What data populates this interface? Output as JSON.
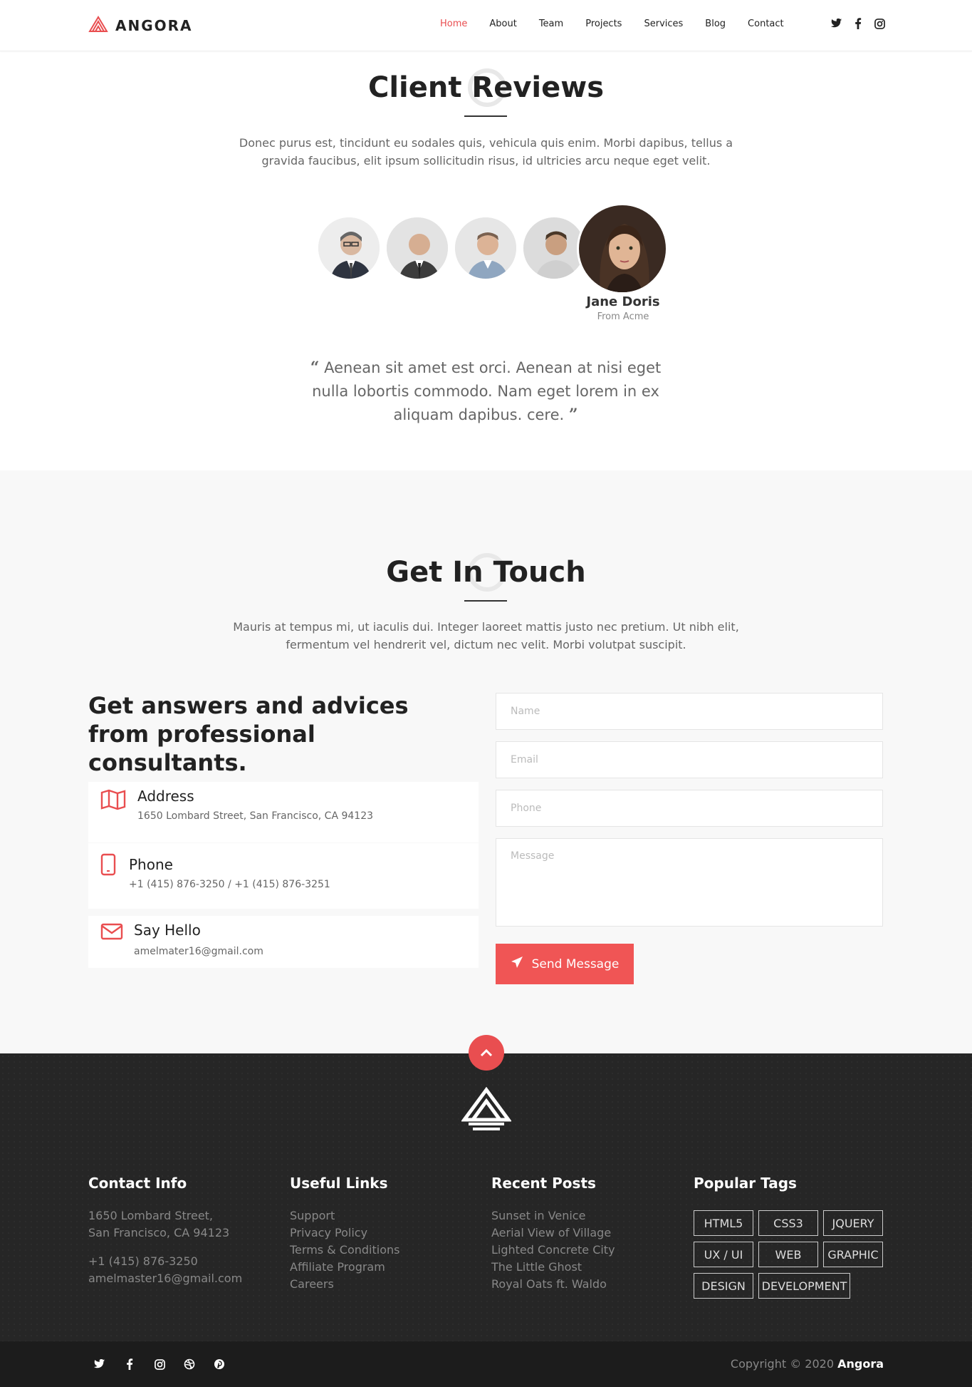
{
  "header": {
    "brand": "ANGORA",
    "nav": [
      "Home",
      "About",
      "Team",
      "Projects",
      "Services",
      "Blog",
      "Contact"
    ],
    "active": "Home",
    "social_icons": [
      "twitter-icon",
      "facebook-icon",
      "instagram-icon"
    ]
  },
  "reviews": {
    "title": "Client Reviews",
    "subtitle_line1": "Donec purus est, tincidunt eu sodales quis, vehicula quis enim. Morbi dapibus, tellus a",
    "subtitle_line2": "gravida faucibus, elit ipsum sollicitudin risus, id ultricies arcu neque eget velit.",
    "active_name": "Jane Doris",
    "active_company": "From Acme",
    "quote": "Aenean sit amet est orci. Aenean at nisi eget nulla lobortis commodo. Nam eget lorem in ex aliquam dapibus. cere."
  },
  "touch": {
    "title": "Get In Touch",
    "subtitle_line1": "Mauris at tempus mi, ut iaculis dui. Integer laoreet mattis justo nec pretium. Ut nibh elit,",
    "subtitle_line2": "fermentum vel hendrerit vel, dictum nec velit. Morbi volutpat suscipit.",
    "heading": "Get answers and advices from professional consultants.",
    "address_title": "Address",
    "address": "1650 Lombard Street, San Francisco, CA 94123",
    "phone_title": "Phone",
    "phone": "+1 (415) 876-3250 / +1 (415) 876-3251",
    "hello_title": "Say Hello",
    "email": "amelmater16@gmail.com",
    "placeholders": {
      "name": "Name",
      "email": "Email",
      "phone": "Phone",
      "message": "Message"
    },
    "send_label": "Send Message"
  },
  "footer": {
    "contact_title": "Contact Info",
    "contact_line1": "1650 Lombard Street,",
    "contact_line2": "San Francisco, CA 94123",
    "contact_phone": "+1 (415) 876-3250",
    "contact_email": "amelmaster16@gmail.com",
    "links_title": "Useful Links",
    "links": [
      "Support",
      "Privacy Policy",
      "Terms & Conditions",
      "Affiliate Program",
      "Careers"
    ],
    "posts_title": "Recent Posts",
    "posts": [
      "Sunset in Venice",
      "Aerial View of Village",
      "Lighted Concrete City",
      "The Little Ghost",
      "Royal Oats ft. Waldo"
    ],
    "tags_title": "Popular Tags",
    "tags": [
      "HTML5",
      "CSS3",
      "JQUERY",
      "UX / UI",
      "WEB",
      "GRAPHIC",
      "DESIGN",
      "DEVELOPMENT"
    ],
    "copyright_prefix": "Copyright © 2020",
    "copyright_brand": "Angora",
    "bottom_social": [
      "twitter-icon",
      "facebook-icon",
      "instagram-icon",
      "dribbble-icon",
      "pinterest-icon"
    ]
  },
  "colors": {
    "accent": "#e94e50",
    "footer": "#262626",
    "bottom_bar": "#1c1c1c",
    "section_bg": "#f8f8f8"
  }
}
